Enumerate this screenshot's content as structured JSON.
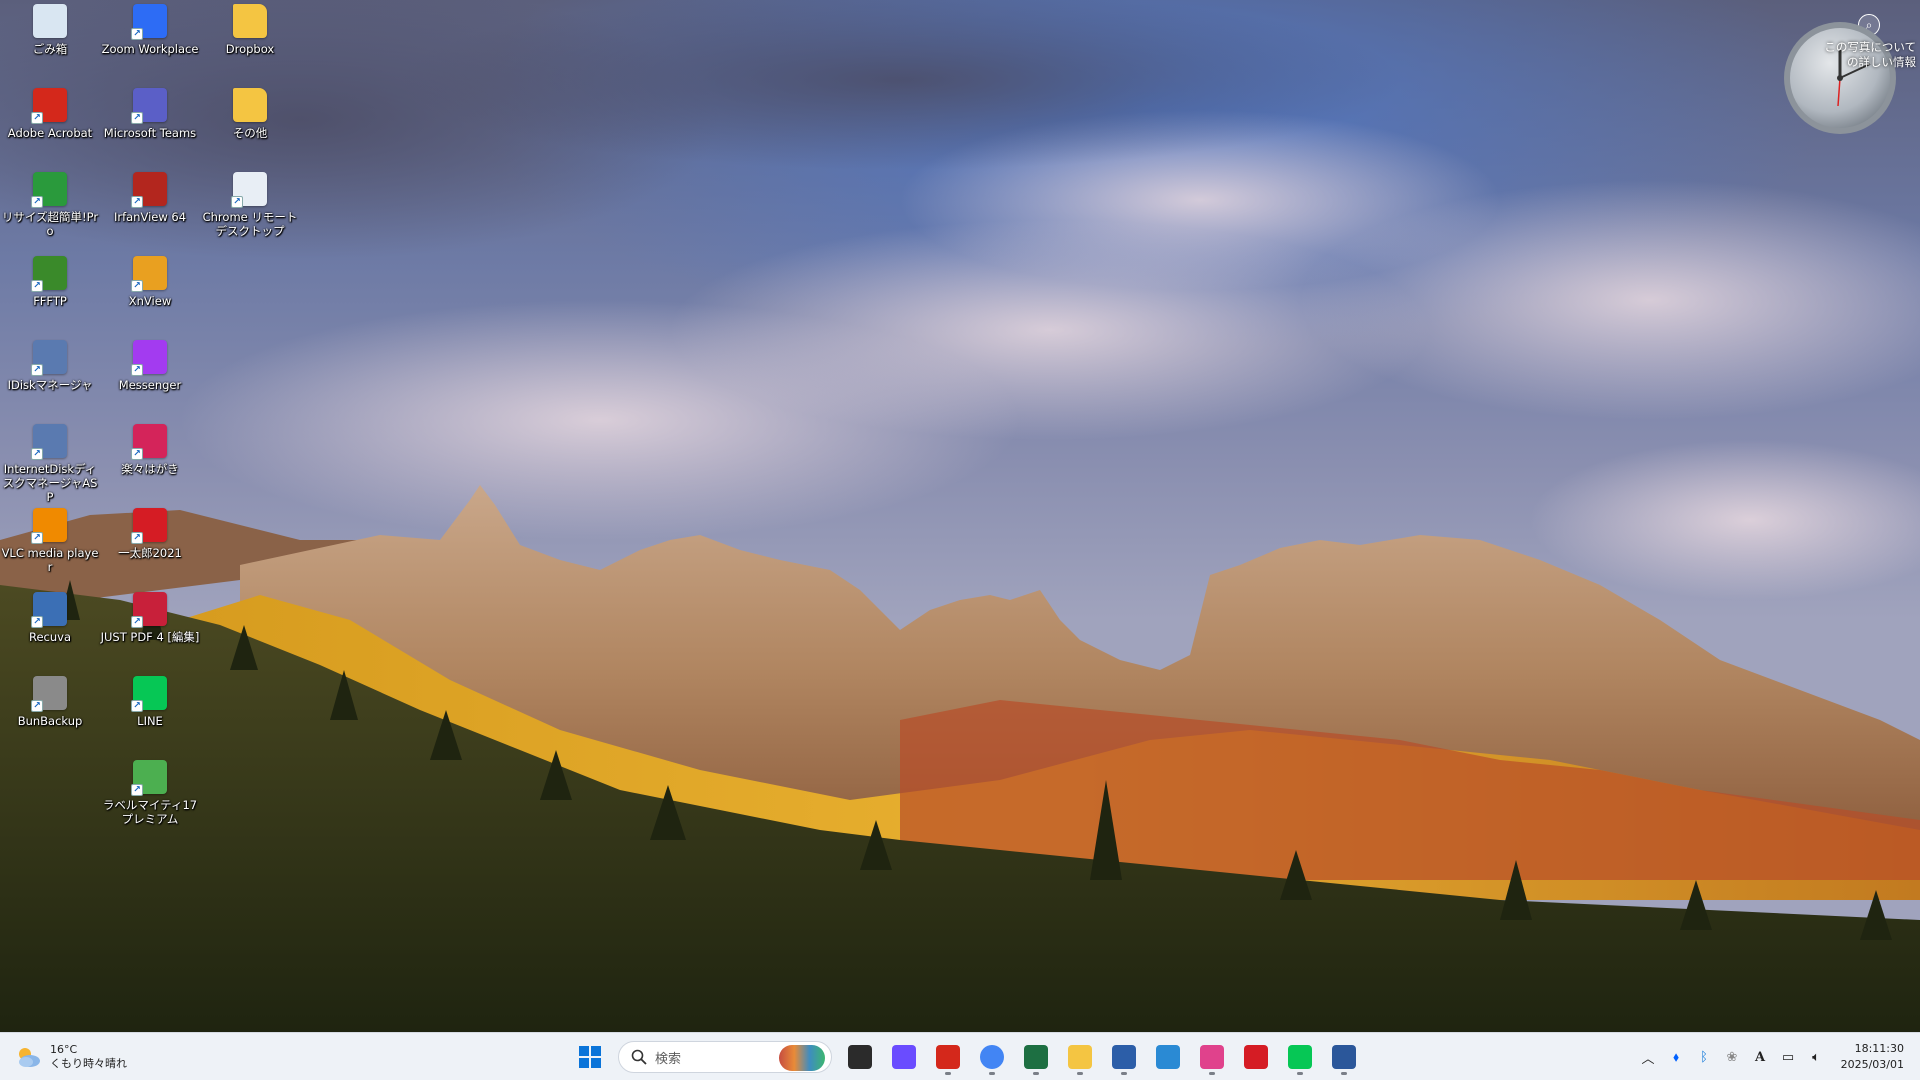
{
  "desktop": {
    "icons": [
      {
        "label": "ごみ箱",
        "icon": "recycle-bin-icon",
        "color": "#d9e6f2"
      },
      {
        "label": "Adobe Acrobat",
        "icon": "adobe-acrobat-icon",
        "color": "#d4281b"
      },
      {
        "label": "リサイズ超簡単!Pro",
        "icon": "resize-pro-icon",
        "color": "#2a9a3c"
      },
      {
        "label": "FFFTP",
        "icon": "ffftp-icon",
        "color": "#3a8a2a"
      },
      {
        "label": "IDiskマネージャ",
        "icon": "idisk-manager-icon",
        "color": "#5a7ab0"
      },
      {
        "label": "InternetDiskディスクマネージャASP",
        "icon": "internetdisk-icon",
        "color": "#5a7ab0"
      },
      {
        "label": "VLC media player",
        "icon": "vlc-icon",
        "color": "#f08a00"
      },
      {
        "label": "Recuva",
        "icon": "recuva-icon",
        "color": "#3b6fb5"
      },
      {
        "label": "BunBackup",
        "icon": "bunbackup-icon",
        "color": "#8a8a8a"
      },
      {
        "label": "Zoom Workplace",
        "icon": "zoom-icon",
        "color": "#2d6cf5"
      },
      {
        "label": "Microsoft Teams",
        "icon": "teams-icon",
        "color": "#5b5fc7"
      },
      {
        "label": "IrfanView 64",
        "icon": "irfanview-icon",
        "color": "#b3261e"
      },
      {
        "label": "XnView",
        "icon": "xnview-icon",
        "color": "#e9a020"
      },
      {
        "label": "Messenger",
        "icon": "messenger-icon",
        "color": "#a33bf0"
      },
      {
        "label": "楽々はがき",
        "icon": "rakuraku-hagaki-icon",
        "color": "#d4245a"
      },
      {
        "label": "一太郎2021",
        "icon": "ichitaro-icon",
        "color": "#d51c24"
      },
      {
        "label": "JUST PDF 4 [編集]",
        "icon": "just-pdf-icon",
        "color": "#c8203a"
      },
      {
        "label": "LINE",
        "icon": "line-icon",
        "color": "#06c755"
      },
      {
        "label": "ラベルマイティ17 プレミアム",
        "icon": "label-mighty-icon",
        "color": "#4caf50"
      },
      {
        "label": "Dropbox",
        "icon": "folder-icon",
        "color": "#f4c542"
      },
      {
        "label": "その他",
        "icon": "folder-icon",
        "color": "#f4c542"
      },
      {
        "label": "Chrome リモートデスクトップ",
        "icon": "chrome-remote-desktop-icon",
        "color": "#e8eef5"
      }
    ],
    "photo_info": "この写真についての詳しい情報"
  },
  "taskbar": {
    "weather": {
      "temp": "16°C",
      "desc": "くもり時々晴れ"
    },
    "search": {
      "placeholder": "検索"
    },
    "apps": [
      {
        "name": "task-view",
        "color": "#2b2b2b",
        "running": false
      },
      {
        "name": "copilot",
        "color": "#6a4cff",
        "running": false
      },
      {
        "name": "acrobat",
        "color": "#d4281b",
        "running": true
      },
      {
        "name": "chrome",
        "color": "#4285f4",
        "running": true
      },
      {
        "name": "excel",
        "color": "#1d6f42",
        "running": true
      },
      {
        "name": "file-explorer",
        "color": "#f4c542",
        "running": true
      },
      {
        "name": "shuwa",
        "color": "#2c5ea8",
        "running": true
      },
      {
        "name": "cc3",
        "color": "#2a8ad4",
        "running": false
      },
      {
        "name": "paint-app",
        "color": "#e0428c",
        "running": true
      },
      {
        "name": "ichitaro",
        "color": "#d51c24",
        "running": false
      },
      {
        "name": "line",
        "color": "#06c755",
        "running": true
      },
      {
        "name": "word",
        "color": "#2b579a",
        "running": true
      }
    ],
    "clock": {
      "time": "18:11:30",
      "date": "2025/03/01"
    },
    "tray_labels": {
      "ime": "A"
    }
  }
}
